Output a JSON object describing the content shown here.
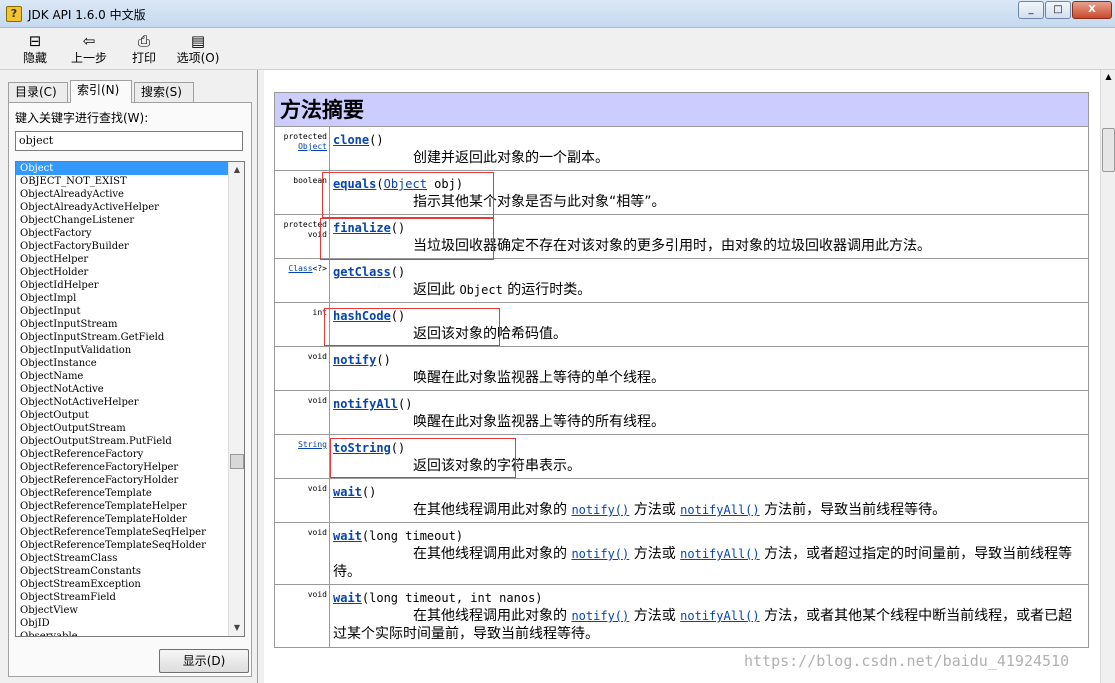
{
  "window": {
    "title": "JDK API 1.6.0 中文版",
    "min": "_",
    "max": "□",
    "close": "X"
  },
  "toolbar": {
    "hide": "隐藏",
    "back": "上一步",
    "print": "打印",
    "options": "选项(O)"
  },
  "tabs": {
    "toc": "目录(C)",
    "index": "索引(N)",
    "search": "搜索(S)"
  },
  "index": {
    "label": "键入关键字进行查找(W):",
    "value": "object",
    "items": [
      "Object",
      "OBJECT_NOT_EXIST",
      "ObjectAlreadyActive",
      "ObjectAlreadyActiveHelper",
      "ObjectChangeListener",
      "ObjectFactory",
      "ObjectFactoryBuilder",
      "ObjectHelper",
      "ObjectHolder",
      "ObjectIdHelper",
      "ObjectImpl",
      "ObjectInput",
      "ObjectInputStream",
      "ObjectInputStream.GetField",
      "ObjectInputValidation",
      "ObjectInstance",
      "ObjectName",
      "ObjectNotActive",
      "ObjectNotActiveHelper",
      "ObjectOutput",
      "ObjectOutputStream",
      "ObjectOutputStream.PutField",
      "ObjectReferenceFactory",
      "ObjectReferenceFactoryHelper",
      "ObjectReferenceFactoryHolder",
      "ObjectReferenceTemplate",
      "ObjectReferenceTemplateHelper",
      "ObjectReferenceTemplateHolder",
      "ObjectReferenceTemplateSeqHelper",
      "ObjectReferenceTemplateSeqHolder",
      "ObjectStreamClass",
      "ObjectStreamConstants",
      "ObjectStreamException",
      "ObjectStreamField",
      "ObjectView",
      "ObjID",
      "Observable"
    ],
    "show_button": "显示(D)"
  },
  "summary": {
    "title": "方法摘要",
    "rows": [
      {
        "mod1": "protected",
        "mod2": "Object",
        "name": "clone",
        "params": "()",
        "desc": "创建并返回此对象的一个副本。"
      },
      {
        "mod1": "boolean",
        "mod2": "",
        "name": "equals",
        "p1": "(",
        "ptype": "Object",
        "p2": " obj)",
        "desc": "指示其他某个对象是否与此对象“相等”。"
      },
      {
        "mod1": "protected",
        "mod2": "void",
        "name": "finalize",
        "params": "()",
        "desc": "当垃圾回收器确定不存在对该对象的更多引用时，由对象的垃圾回收器调用此方法。"
      },
      {
        "mod1": "Class",
        "mod2": "<?>",
        "name": "getClass",
        "params": "()",
        "d1": "返回此 ",
        "dcode": "Object",
        "d2": " 的运行时类。"
      },
      {
        "mod1": "int",
        "mod2": "",
        "name": "hashCode",
        "params": "()",
        "desc": "返回该对象的哈希码值。"
      },
      {
        "mod1": "void",
        "mod2": "",
        "name": "notify",
        "params": "()",
        "desc": "唤醒在此对象监视器上等待的单个线程。"
      },
      {
        "mod1": "void",
        "mod2": "",
        "name": "notifyAll",
        "params": "()",
        "desc": "唤醒在此对象监视器上等待的所有线程。"
      },
      {
        "mod1": "String",
        "mod2": "",
        "name": "toString",
        "params": "()",
        "desc": "返回该对象的字符串表示。"
      },
      {
        "mod1": "void",
        "mod2": "",
        "name": "wait",
        "params": "()",
        "d1": "在其他线程调用此对象的 ",
        "l1": "notify()",
        "d2": " 方法或 ",
        "l2": "notifyAll()",
        "d3": " 方法前，导致当前线程等待。"
      },
      {
        "mod1": "void",
        "mod2": "",
        "name": "wait",
        "params": "(long timeout)",
        "d1": "在其他线程调用此对象的 ",
        "l1": "notify()",
        "d2": " 方法或 ",
        "l2": "notifyAll()",
        "d3": " 方法，或者超过指定的时间量前，导致当前线程等待。"
      },
      {
        "mod1": "void",
        "mod2": "",
        "name": "wait",
        "params": "(long timeout, int nanos)",
        "d1": "在其他线程调用此对象的 ",
        "l1": "notify()",
        "d2": " 方法或 ",
        "l2": "notifyAll()",
        "d3": " 方法，或者其他某个线程中断当前线程，或者已超过某个实际时间量前，导致当前线程等待。"
      }
    ]
  },
  "watermark": "https://blog.csdn.net/baidu_41924510"
}
